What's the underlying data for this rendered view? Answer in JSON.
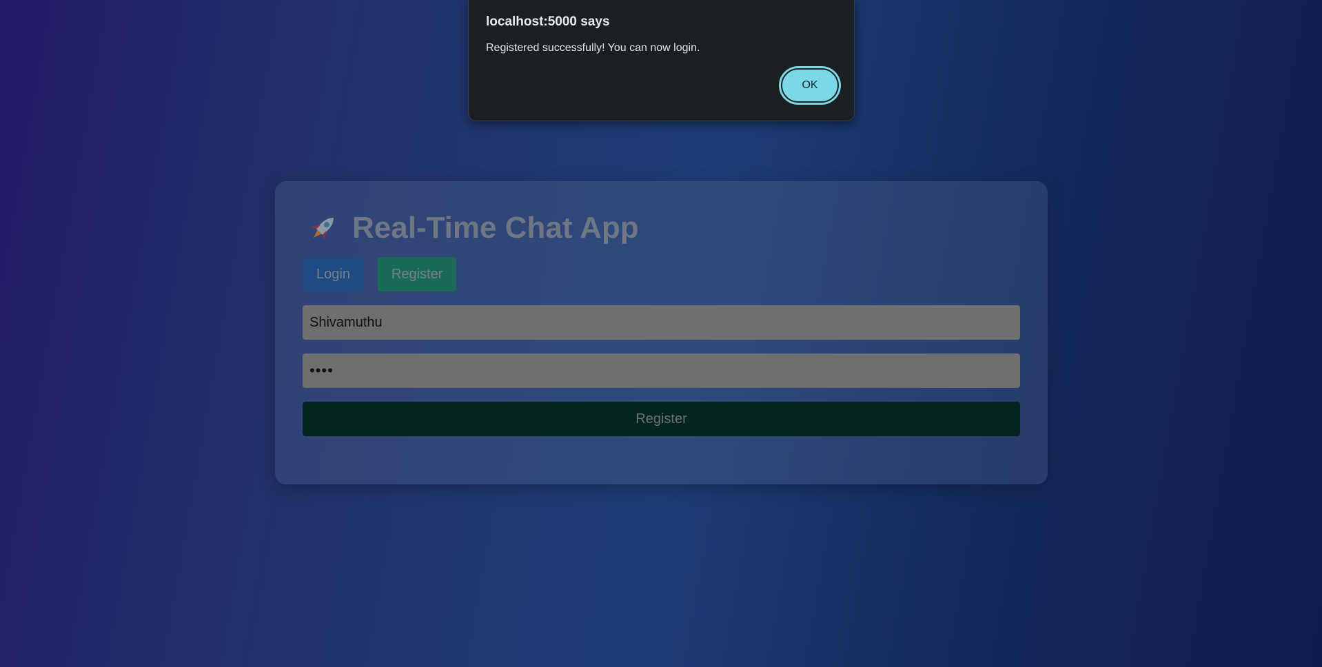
{
  "app": {
    "title": "Real-Time Chat App",
    "logo_icon": "rocket-icon"
  },
  "tabs": {
    "login_label": "Login",
    "register_label": "Register"
  },
  "form": {
    "username_value": "Shivamuthu",
    "password_value": "••••",
    "submit_label": "Register"
  },
  "dialog": {
    "title": "localhost:5000 says",
    "message": "Registered successfully! You can now login.",
    "ok_label": "OK"
  },
  "colors": {
    "login_tab": "#1f4a82",
    "register_tab": "#1b6a58",
    "submit_button": "#03241f",
    "ok_button": "#7cd8e4",
    "dialog_background": "#1b1f22"
  }
}
